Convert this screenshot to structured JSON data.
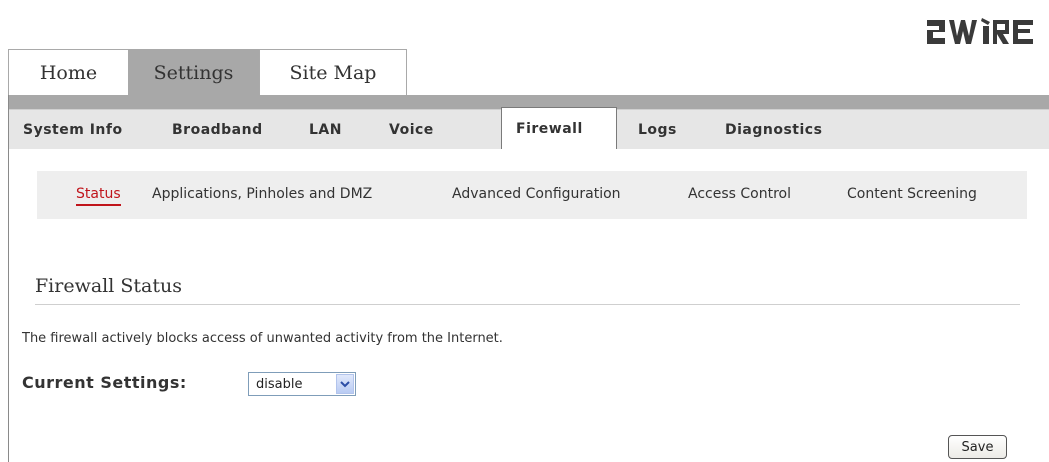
{
  "brand": {
    "logo_text": "2WIRE",
    "logo_color": "#3a3a3a"
  },
  "top_tabs": [
    {
      "label": "Home"
    },
    {
      "label": "Settings"
    },
    {
      "label": "Site Map"
    }
  ],
  "sub_tabs": [
    {
      "label": "System Info"
    },
    {
      "label": "Broadband"
    },
    {
      "label": "LAN"
    },
    {
      "label": "Voice"
    },
    {
      "label": "Firewall"
    },
    {
      "label": "Logs"
    },
    {
      "label": "Diagnostics"
    }
  ],
  "firewall_nav": [
    {
      "label": "Status"
    },
    {
      "label": "Applications, Pinholes and DMZ"
    },
    {
      "label": "Advanced Configuration"
    },
    {
      "label": "Access Control"
    },
    {
      "label": "Content Screening"
    }
  ],
  "section": {
    "title": "Firewall Status",
    "description": "The firewall actively blocks access of unwanted activity from the Internet."
  },
  "current_settings": {
    "label": "Current Settings:",
    "selected": "disable"
  },
  "actions": {
    "save_label": "Save"
  },
  "colors": {
    "accent": "#c0141b",
    "frame": "#a8a8a8"
  }
}
